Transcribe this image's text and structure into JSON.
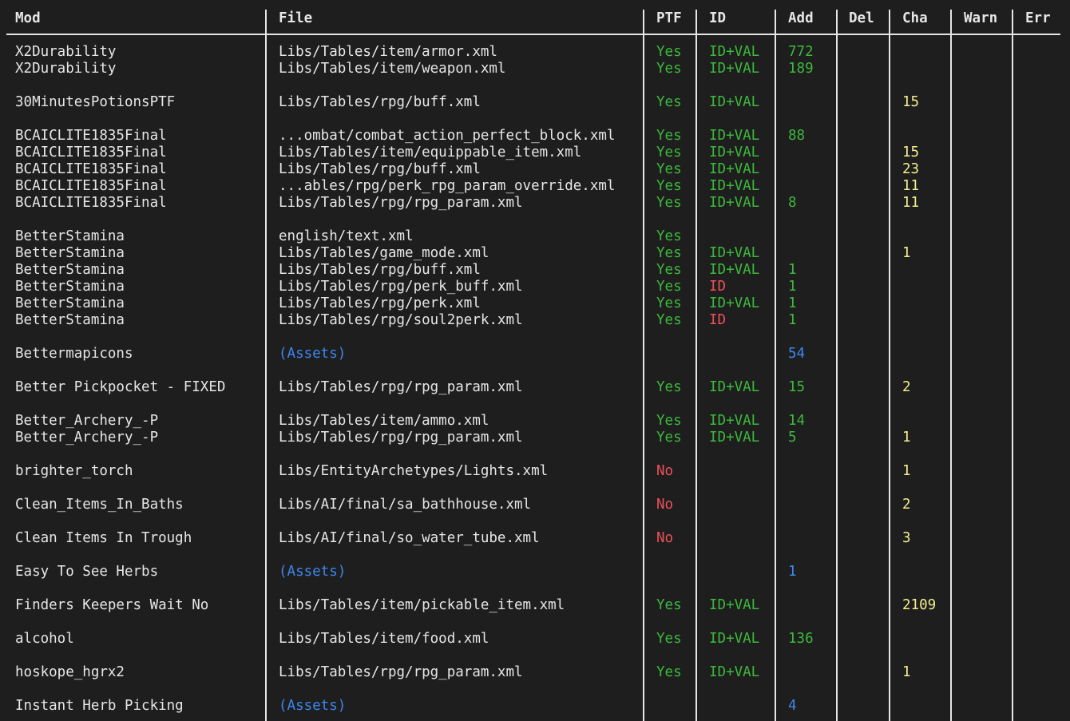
{
  "colors": {
    "background": "#1e1e1e",
    "text": "#e6e6e6",
    "yes_green": "#3cb93c",
    "no_red": "#ef4f5a",
    "assets_blue": "#3f86f0",
    "changes_yellow": "#f2ee8f"
  },
  "headers": {
    "mod": "Mod",
    "file": "File",
    "ptf": "PTF",
    "id": "ID",
    "add": "Add",
    "del": "Del",
    "cha": "Cha",
    "warn": "Warn",
    "err": "Err"
  },
  "rows": [
    {
      "mod": "X2Durability",
      "file": "Libs/Tables/item/armor.xml",
      "ptf": "Yes",
      "id": "ID+VAL",
      "add": "772",
      "cha": ""
    },
    {
      "mod": "X2Durability",
      "file": "Libs/Tables/item/weapon.xml",
      "ptf": "Yes",
      "id": "ID+VAL",
      "add": "189",
      "cha": ""
    },
    {
      "mod": "30MinutesPotionsPTF",
      "file": "Libs/Tables/rpg/buff.xml",
      "ptf": "Yes",
      "id": "ID+VAL",
      "add": "",
      "cha": "15"
    },
    {
      "mod": "BCAICLITE1835Final",
      "file": "...ombat/combat_action_perfect_block.xml",
      "ptf": "Yes",
      "id": "ID+VAL",
      "add": "88",
      "cha": ""
    },
    {
      "mod": "BCAICLITE1835Final",
      "file": "Libs/Tables/item/equippable_item.xml",
      "ptf": "Yes",
      "id": "ID+VAL",
      "add": "",
      "cha": "15"
    },
    {
      "mod": "BCAICLITE1835Final",
      "file": "Libs/Tables/rpg/buff.xml",
      "ptf": "Yes",
      "id": "ID+VAL",
      "add": "",
      "cha": "23"
    },
    {
      "mod": "BCAICLITE1835Final",
      "file": "...ables/rpg/perk_rpg_param_override.xml",
      "ptf": "Yes",
      "id": "ID+VAL",
      "add": "",
      "cha": "11"
    },
    {
      "mod": "BCAICLITE1835Final",
      "file": "Libs/Tables/rpg/rpg_param.xml",
      "ptf": "Yes",
      "id": "ID+VAL",
      "add": "8",
      "cha": "11"
    },
    {
      "mod": "BetterStamina",
      "file": "english/text.xml",
      "ptf": "Yes",
      "id": "",
      "add": "",
      "cha": ""
    },
    {
      "mod": "BetterStamina",
      "file": "Libs/Tables/game_mode.xml",
      "ptf": "Yes",
      "id": "ID+VAL",
      "add": "",
      "cha": "1"
    },
    {
      "mod": "BetterStamina",
      "file": "Libs/Tables/rpg/buff.xml",
      "ptf": "Yes",
      "id": "ID+VAL",
      "add": "1",
      "cha": ""
    },
    {
      "mod": "BetterStamina",
      "file": "Libs/Tables/rpg/perk_buff.xml",
      "ptf": "Yes",
      "id": "ID",
      "add": "1",
      "cha": ""
    },
    {
      "mod": "BetterStamina",
      "file": "Libs/Tables/rpg/perk.xml",
      "ptf": "Yes",
      "id": "ID+VAL",
      "add": "1",
      "cha": ""
    },
    {
      "mod": "BetterStamina",
      "file": "Libs/Tables/rpg/soul2perk.xml",
      "ptf": "Yes",
      "id": "ID",
      "add": "1",
      "cha": ""
    },
    {
      "mod": "Bettermapicons",
      "file": "(Assets)",
      "ptf": "",
      "id": "",
      "add": "54",
      "cha": ""
    },
    {
      "mod": "Better Pickpocket - FIXED",
      "file": "Libs/Tables/rpg/rpg_param.xml",
      "ptf": "Yes",
      "id": "ID+VAL",
      "add": "15",
      "cha": "2"
    },
    {
      "mod": "Better_Archery_-P",
      "file": "Libs/Tables/item/ammo.xml",
      "ptf": "Yes",
      "id": "ID+VAL",
      "add": "14",
      "cha": ""
    },
    {
      "mod": "Better_Archery_-P",
      "file": "Libs/Tables/rpg/rpg_param.xml",
      "ptf": "Yes",
      "id": "ID+VAL",
      "add": "5",
      "cha": "1"
    },
    {
      "mod": "brighter_torch",
      "file": "Libs/EntityArchetypes/Lights.xml",
      "ptf": "No",
      "id": "",
      "add": "",
      "cha": "1"
    },
    {
      "mod": "Clean_Items_In_Baths",
      "file": "Libs/AI/final/sa_bathhouse.xml",
      "ptf": "No",
      "id": "",
      "add": "",
      "cha": "2"
    },
    {
      "mod": "Clean Items In Trough",
      "file": "Libs/AI/final/so_water_tube.xml",
      "ptf": "No",
      "id": "",
      "add": "",
      "cha": "3"
    },
    {
      "mod": "Easy To See Herbs",
      "file": "(Assets)",
      "ptf": "",
      "id": "",
      "add": "1",
      "cha": ""
    },
    {
      "mod": "Finders Keepers Wait No",
      "file": "Libs/Tables/item/pickable_item.xml",
      "ptf": "Yes",
      "id": "ID+VAL",
      "add": "",
      "cha": "2109"
    },
    {
      "mod": "alcohol",
      "file": "Libs/Tables/item/food.xml",
      "ptf": "Yes",
      "id": "ID+VAL",
      "add": "136",
      "cha": ""
    },
    {
      "mod": "hoskope_hgrx2",
      "file": "Libs/Tables/rpg/rpg_param.xml",
      "ptf": "Yes",
      "id": "ID+VAL",
      "add": "",
      "cha": "1"
    },
    {
      "mod": "Instant Herb Picking",
      "file": "(Assets)",
      "ptf": "",
      "id": "",
      "add": "4",
      "cha": ""
    }
  ]
}
